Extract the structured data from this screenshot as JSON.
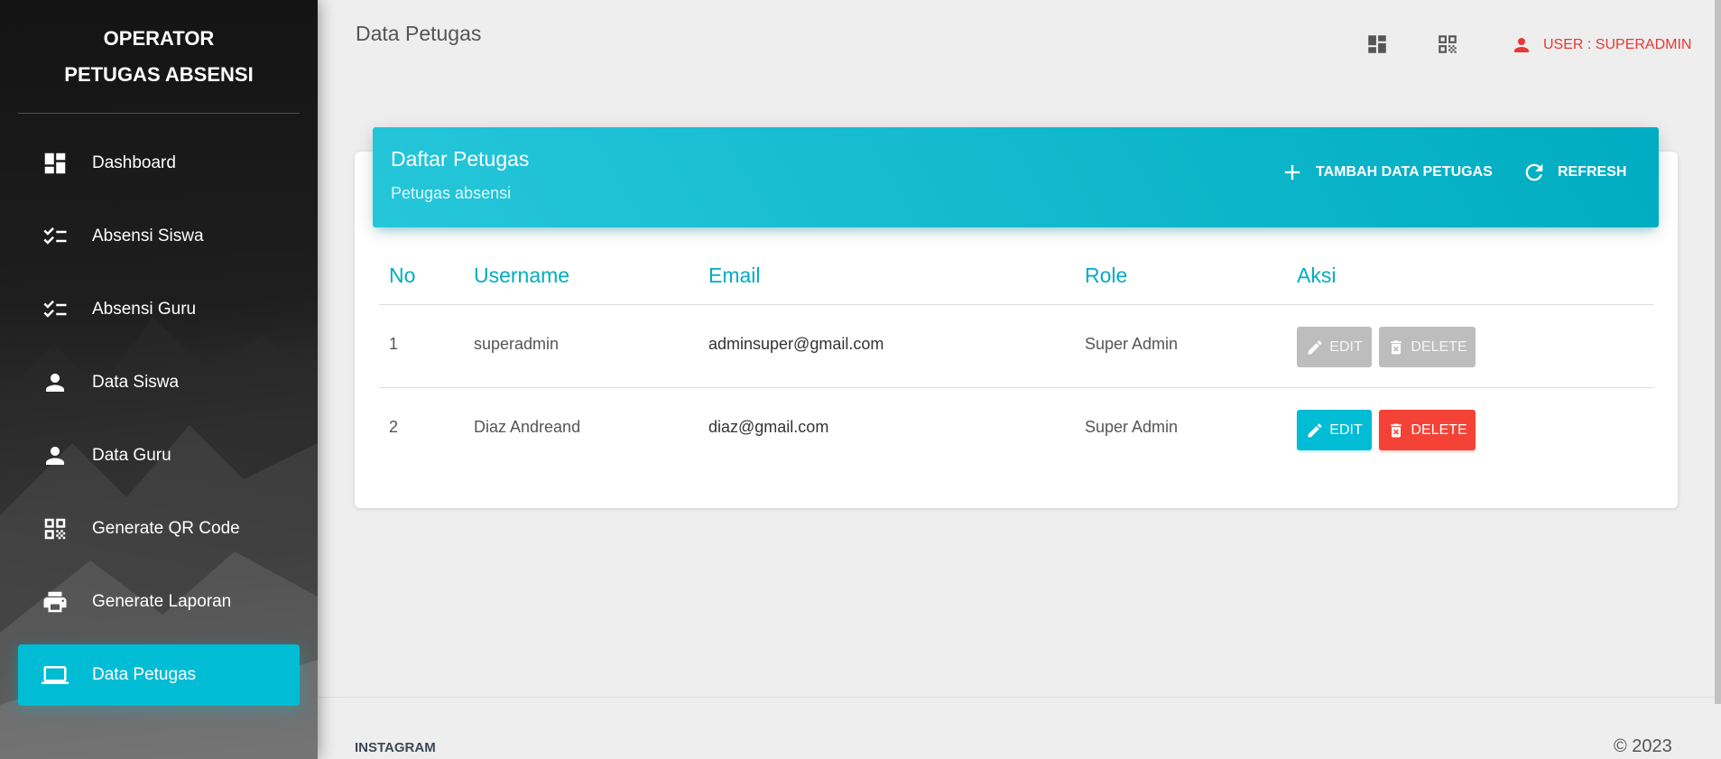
{
  "sidebar": {
    "brand_line1": "OPERATOR",
    "brand_line2": "PETUGAS ABSENSI",
    "items": [
      {
        "label": "Dashboard",
        "icon": "dashboard-icon"
      },
      {
        "label": "Absensi Siswa",
        "icon": "checklist-icon"
      },
      {
        "label": "Absensi Guru",
        "icon": "checklist-icon"
      },
      {
        "label": "Data Siswa",
        "icon": "person-icon"
      },
      {
        "label": "Data Guru",
        "icon": "person-icon"
      },
      {
        "label": "Generate QR Code",
        "icon": "qr-code-icon"
      },
      {
        "label": "Generate Laporan",
        "icon": "print-icon"
      },
      {
        "label": "Data Petugas",
        "icon": "laptop-icon",
        "active": true
      }
    ]
  },
  "header": {
    "page_title": "Data Petugas",
    "user_label": "USER : SUPERADMIN"
  },
  "card": {
    "title": "Daftar Petugas",
    "subtitle": "Petugas absensi",
    "add_label": "TAMBAH DATA PETUGAS",
    "refresh_label": "REFRESH"
  },
  "table": {
    "headers": [
      "No",
      "Username",
      "Email",
      "Role",
      "Aksi"
    ],
    "rows": [
      {
        "no": "1",
        "username": "superadmin",
        "email": "adminsuper@gmail.com",
        "role": "Super Admin",
        "edit": "EDIT",
        "delete": "DELETE",
        "disabled": true
      },
      {
        "no": "2",
        "username": "Diaz Andreand",
        "email": "diaz@gmail.com",
        "role": "Super Admin",
        "edit": "EDIT",
        "delete": "DELETE",
        "disabled": false
      }
    ]
  },
  "footer": {
    "link": "INSTAGRAM",
    "copyright": "© 2023"
  },
  "colors": {
    "accent": "#00bcd4",
    "danger": "#f44336",
    "user": "#e53935"
  }
}
